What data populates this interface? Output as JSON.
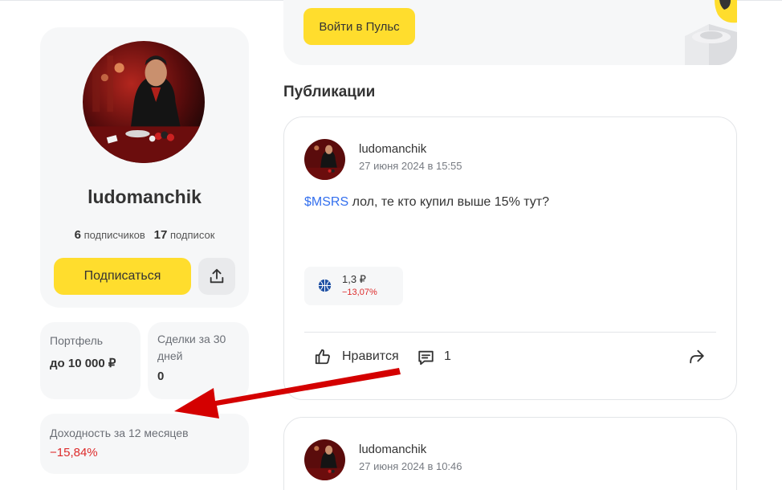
{
  "profile": {
    "name": "ludomanchik",
    "followers_count": "6",
    "followers_label": "подписчиков",
    "following_count": "17",
    "following_label": "подписок",
    "subscribe_label": "Подписаться",
    "share_icon": "upload-share-icon"
  },
  "stats": {
    "portfolio_label": "Портфель",
    "portfolio_value": "до 10 000 ₽",
    "deals_label": "Сделки за 30 дней",
    "deals_value": "0",
    "yield_label": "Доходность за 12 месяцев",
    "yield_value": "−15,84%"
  },
  "promo": {
    "button_label": "Войти в Пульс"
  },
  "publications": {
    "title": "Публикации",
    "posts": [
      {
        "author": "ludomanchik",
        "date": "27 июня 2024 в 15:55",
        "ticker": "$MSRS",
        "text": " лол, те кто купил выше 15% тут?",
        "instrument": {
          "price": "1,3 ₽",
          "change": "−13,07%"
        },
        "like_label": "Нравится",
        "comments_count": "1"
      },
      {
        "author": "ludomanchik",
        "date": "27 июня 2024 в 10:46"
      }
    ]
  },
  "colors": {
    "accent_yellow": "#ffdd2d",
    "negative_red": "#dd2a2a",
    "ticker_blue": "#336fee",
    "annotation_arrow": "#d40000"
  }
}
